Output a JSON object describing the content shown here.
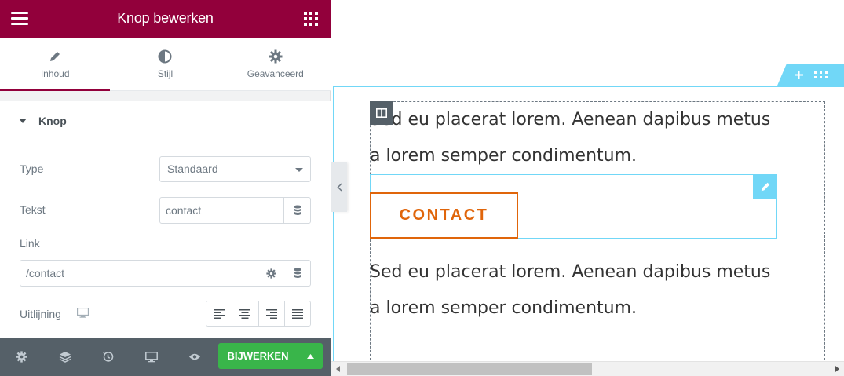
{
  "panel": {
    "header_title": "Knop bewerken",
    "tabs": [
      {
        "label": "Inhoud",
        "icon": "pencil-icon",
        "active": true
      },
      {
        "label": "Stijl",
        "icon": "half-circle-icon",
        "active": false
      },
      {
        "label": "Geavanceerd",
        "icon": "gear-icon",
        "active": false
      }
    ],
    "section_title": "Knop",
    "controls": {
      "type_label": "Type",
      "type_value": "Standaard",
      "text_label": "Tekst",
      "text_value": "contact",
      "link_label": "Link",
      "link_value": "/contact",
      "align_label": "Uitlijning"
    },
    "footer": {
      "publish_label": "BIJWERKEN"
    }
  },
  "canvas": {
    "paragraph_top": "Sed eu placerat lorem. Aenean dapibus metus a lorem semper condimentum.",
    "button_label": "CONTACT",
    "paragraph_bottom": "Sed eu placerat lorem. Aenean dapibus metus a lorem semper condimentum."
  },
  "colors": {
    "brand": "#92003b",
    "accent": "#71d7f7",
    "button": "#e0650a",
    "publish": "#39b54a",
    "footer_bg": "#556068"
  }
}
